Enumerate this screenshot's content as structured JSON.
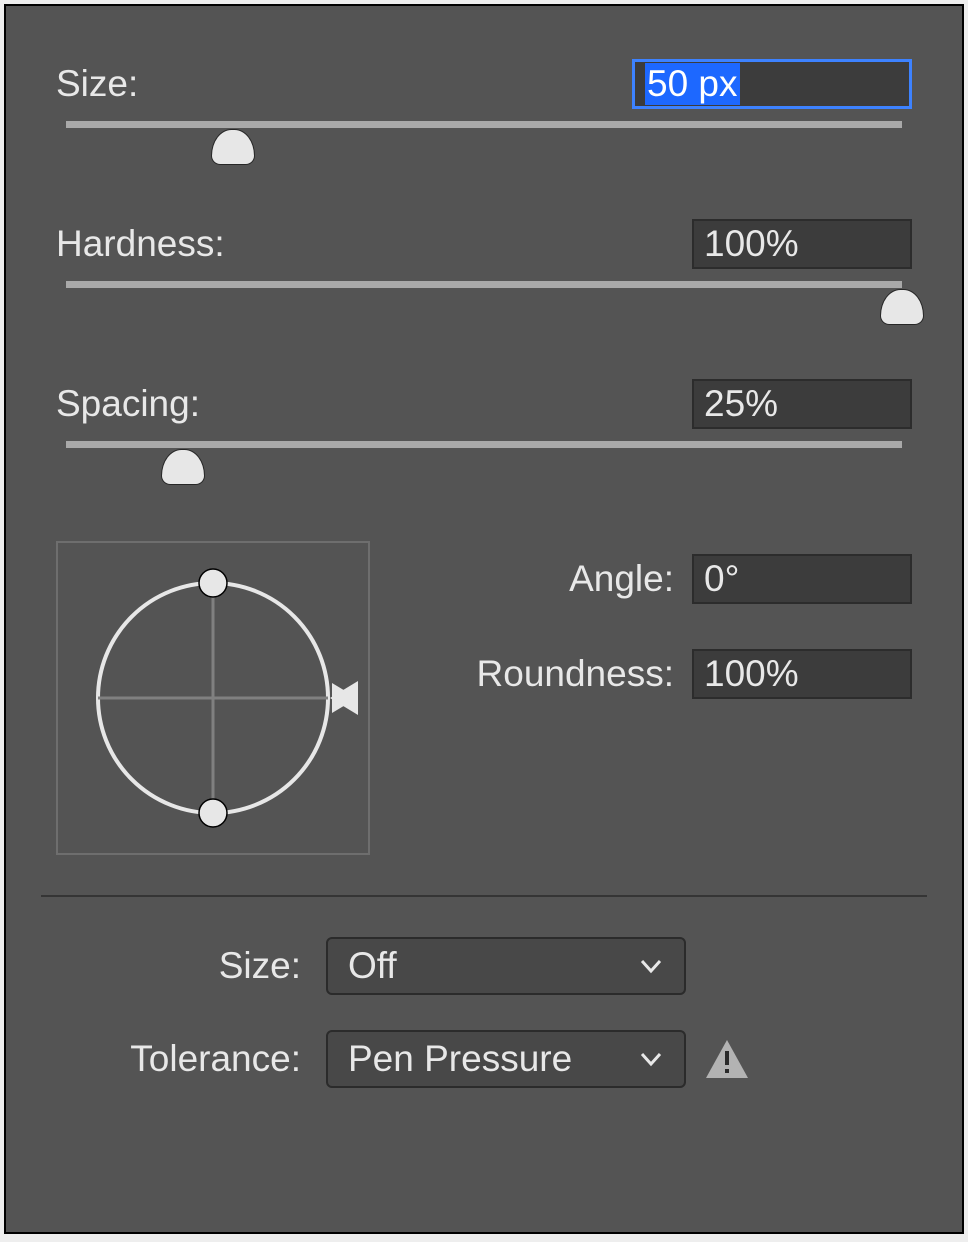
{
  "size": {
    "label": "Size:",
    "value": "50 px",
    "slider_percent": 20
  },
  "hardness": {
    "label": "Hardness:",
    "value": "100%",
    "slider_percent": 100
  },
  "spacing": {
    "label": "Spacing:",
    "value": "25%",
    "slider_percent": 14
  },
  "angle": {
    "label": "Angle:",
    "value": "0°"
  },
  "roundness": {
    "label": "Roundness:",
    "value": "100%"
  },
  "dynamics_size": {
    "label": "Size:",
    "value": "Off"
  },
  "dynamics_tolerance": {
    "label": "Tolerance:",
    "value": "Pen Pressure"
  }
}
